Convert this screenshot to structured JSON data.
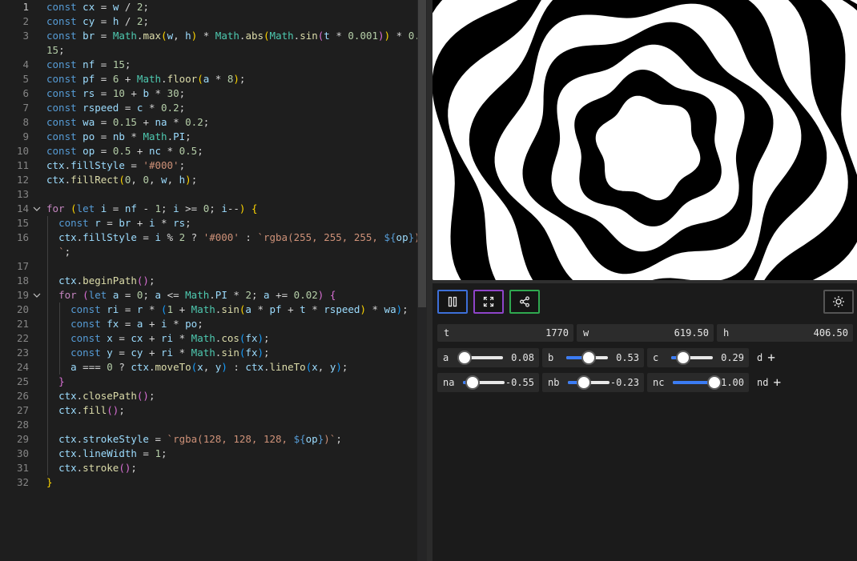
{
  "editor": {
    "lines": [
      {
        "num": "1",
        "html": "<span class=\"k\">const</span> <span class=\"v\">cx</span> = <span class=\"v\">w</span> / <span class=\"n\">2</span>;"
      },
      {
        "num": "2",
        "html": "<span class=\"k\">const</span> <span class=\"v\">cy</span> = <span class=\"v\">h</span> / <span class=\"n\">2</span>;"
      },
      {
        "num": "3",
        "html": "<span class=\"k\">const</span> <span class=\"v\">br</span> = <span class=\"t\">Math</span>.<span class=\"f\">max</span><span class=\"b1\">(</span><span class=\"v\">w</span>, <span class=\"v\">h</span><span class=\"b1\">)</span> * <span class=\"t\">Math</span>.<span class=\"f\">abs</span><span class=\"b1\">(</span><span class=\"t\">Math</span>.<span class=\"f\">sin</span><span class=\"b2\">(</span><span class=\"v\">t</span> * <span class=\"n\">0.001</span><span class=\"b2\">)</span><span class=\"b1\">)</span> * <span class=\"n\">0.</span>"
      },
      {
        "num": "",
        "html": "<span class=\"n\">15</span>;"
      },
      {
        "num": "4",
        "html": "<span class=\"k\">const</span> <span class=\"v\">nf</span> = <span class=\"n\">15</span>;"
      },
      {
        "num": "5",
        "html": "<span class=\"k\">const</span> <span class=\"v\">pf</span> = <span class=\"n\">6</span> + <span class=\"t\">Math</span>.<span class=\"f\">floor</span><span class=\"b1\">(</span><span class=\"v\">a</span> * <span class=\"n\">8</span><span class=\"b1\">)</span>;"
      },
      {
        "num": "6",
        "html": "<span class=\"k\">const</span> <span class=\"v\">rs</span> = <span class=\"n\">10</span> + <span class=\"v\">b</span> * <span class=\"n\">30</span>;"
      },
      {
        "num": "7",
        "html": "<span class=\"k\">const</span> <span class=\"v\">rspeed</span> = <span class=\"v\">c</span> * <span class=\"n\">0.2</span>;"
      },
      {
        "num": "8",
        "html": "<span class=\"k\">const</span> <span class=\"v\">wa</span> = <span class=\"n\">0.15</span> + <span class=\"v\">na</span> * <span class=\"n\">0.2</span>;"
      },
      {
        "num": "9",
        "html": "<span class=\"k\">const</span> <span class=\"v\">po</span> = <span class=\"v\">nb</span> * <span class=\"t\">Math</span>.<span class=\"v\">PI</span>;"
      },
      {
        "num": "10",
        "html": "<span class=\"k\">const</span> <span class=\"v\">op</span> = <span class=\"n\">0.5</span> + <span class=\"v\">nc</span> * <span class=\"n\">0.5</span>;"
      },
      {
        "num": "11",
        "html": "<span class=\"v\">ctx</span>.<span class=\"v\">fillStyle</span> = <span class=\"s\">'#000'</span>;"
      },
      {
        "num": "12",
        "html": "<span class=\"v\">ctx</span>.<span class=\"f\">fillRect</span><span class=\"b1\">(</span><span class=\"n\">0</span>, <span class=\"n\">0</span>, <span class=\"v\">w</span>, <span class=\"v\">h</span><span class=\"b1\">)</span>;"
      },
      {
        "num": "13",
        "html": ""
      },
      {
        "num": "14",
        "html": "<span class=\"c\">for</span> <span class=\"b1\">(</span><span class=\"k\">let</span> <span class=\"v\">i</span> = <span class=\"v\">nf</span> - <span class=\"n\">1</span>; <span class=\"v\">i</span> &gt;= <span class=\"n\">0</span>; <span class=\"v\">i</span>--<span class=\"b1\">)</span> <span class=\"b1\">{</span>"
      },
      {
        "num": "15",
        "html": "  <span class=\"k\">const</span> <span class=\"v\">r</span> = <span class=\"v\">br</span> + <span class=\"v\">i</span> * <span class=\"v\">rs</span>;"
      },
      {
        "num": "16",
        "html": "  <span class=\"v\">ctx</span>.<span class=\"v\">fillStyle</span> = <span class=\"v\">i</span> % <span class=\"n\">2</span> ? <span class=\"s\">'#000'</span> : <span class=\"s\">`rgba(255, 255, 255, </span><span class=\"k\">${</span><span class=\"v\">op</span><span class=\"k\">}</span><span class=\"s\">)</span>"
      },
      {
        "num": "",
        "html": "  <span class=\"s\">`</span>;"
      },
      {
        "num": "17",
        "html": ""
      },
      {
        "num": "18",
        "html": "  <span class=\"v\">ctx</span>.<span class=\"f\">beginPath</span><span class=\"b2\">()</span>;"
      },
      {
        "num": "19",
        "html": "  <span class=\"c\">for</span> <span class=\"b2\">(</span><span class=\"k\">let</span> <span class=\"v\">a</span> = <span class=\"n\">0</span>; <span class=\"v\">a</span> &lt;= <span class=\"t\">Math</span>.<span class=\"v\">PI</span> * <span class=\"n\">2</span>; <span class=\"v\">a</span> += <span class=\"n\">0.02</span><span class=\"b2\">)</span> <span class=\"b2\">{</span>"
      },
      {
        "num": "20",
        "html": "    <span class=\"k\">const</span> <span class=\"v\">ri</span> = <span class=\"v\">r</span> * <span class=\"b3\">(</span><span class=\"n\">1</span> + <span class=\"t\">Math</span>.<span class=\"f\">sin</span><span class=\"b1\">(</span><span class=\"v\">a</span> * <span class=\"v\">pf</span> + <span class=\"v\">t</span> * <span class=\"v\">rspeed</span><span class=\"b1\">)</span> * <span class=\"v\">wa</span><span class=\"b3\">)</span>;"
      },
      {
        "num": "21",
        "html": "    <span class=\"k\">const</span> <span class=\"v\">fx</span> = <span class=\"v\">a</span> + <span class=\"v\">i</span> * <span class=\"v\">po</span>;"
      },
      {
        "num": "22",
        "html": "    <span class=\"k\">const</span> <span class=\"v\">x</span> = <span class=\"v\">cx</span> + <span class=\"v\">ri</span> * <span class=\"t\">Math</span>.<span class=\"f\">cos</span><span class=\"b3\">(</span><span class=\"v\">fx</span><span class=\"b3\">)</span>;"
      },
      {
        "num": "23",
        "html": "    <span class=\"k\">const</span> <span class=\"v\">y</span> = <span class=\"v\">cy</span> + <span class=\"v\">ri</span> * <span class=\"t\">Math</span>.<span class=\"f\">sin</span><span class=\"b3\">(</span><span class=\"v\">fx</span><span class=\"b3\">)</span>;"
      },
      {
        "num": "24",
        "html": "    <span class=\"v\">a</span> === <span class=\"n\">0</span> ? <span class=\"v\">ctx</span>.<span class=\"f\">moveTo</span><span class=\"b3\">(</span><span class=\"v\">x</span>, <span class=\"v\">y</span><span class=\"b3\">)</span> : <span class=\"v\">ctx</span>.<span class=\"f\">lineTo</span><span class=\"b3\">(</span><span class=\"v\">x</span>, <span class=\"v\">y</span><span class=\"b3\">)</span>;"
      },
      {
        "num": "25",
        "html": "  <span class=\"b2\">}</span>"
      },
      {
        "num": "26",
        "html": "  <span class=\"v\">ctx</span>.<span class=\"f\">closePath</span><span class=\"b2\">()</span>;"
      },
      {
        "num": "27",
        "html": "  <span class=\"v\">ctx</span>.<span class=\"f\">fill</span><span class=\"b2\">()</span>;"
      },
      {
        "num": "28",
        "html": ""
      },
      {
        "num": "29",
        "html": "  <span class=\"v\">ctx</span>.<span class=\"v\">strokeStyle</span> = <span class=\"s\">`rgba(128, 128, 128, </span><span class=\"k\">${</span><span class=\"v\">op</span><span class=\"k\">}</span><span class=\"s\">)`</span>;"
      },
      {
        "num": "30",
        "html": "  <span class=\"v\">ctx</span>.<span class=\"v\">lineWidth</span> = <span class=\"n\">1</span>;"
      },
      {
        "num": "31",
        "html": "  <span class=\"v\">ctx</span>.<span class=\"f\">stroke</span><span class=\"b2\">()</span>;"
      },
      {
        "num": "32",
        "html": "<span class=\"b1\">}</span>"
      }
    ],
    "text": [
      "const cx = w / 2;",
      "const cy = h / 2;",
      "const br = Math.max(w, h) * Math.abs(Math.sin(t * 0.001)) * 0.",
      "15;",
      "const nf = 15;",
      "const pf = 6 + Math.floor(a * 8);",
      "const rs = 10 + b * 30;",
      "const rspeed = c * 0.2;",
      "const wa = 0.15 + na * 0.2;",
      "const po = nb * Math.PI;",
      "const op = 0.5 + nc * 0.5;",
      "ctx.fillStyle = '#000';",
      "ctx.fillRect(0, 0, w, h);",
      "",
      "for (let i = nf - 1; i >= 0; i--) {",
      "  const r = br + i * rs;",
      "  ctx.fillStyle = i % 2 ? '#000' : `rgba(255, 255, 255, ${op})",
      "  `;",
      "",
      "  ctx.beginPath();",
      "  for (let a = 0; a <= Math.PI * 2; a += 0.02) {",
      "    const ri = r * (1 + Math.sin(a * pf + t * rspeed) * wa);",
      "    const fx = a + i * po;",
      "    const x = cx + ri * Math.cos(fx);",
      "    const y = cy + ri * Math.sin(fx);",
      "    a === 0 ? ctx.moveTo(x, y) : ctx.lineTo(x, y);",
      "  }",
      "  ctx.closePath();",
      "  ctx.fill();",
      "",
      "  ctx.strokeStyle = `rgba(128, 128, 128, ${op})`;",
      "  ctx.lineWidth = 1;",
      "  ctx.stroke();",
      "}"
    ],
    "active_line": "1",
    "fold_lines": [
      "14",
      "19"
    ]
  },
  "toolbar": {
    "pause_icon": "pause-icon",
    "fullscreen_icon": "fullscreen-icon",
    "share_icon": "share-icon",
    "theme_icon": "sun-icon",
    "colors": {
      "pause": "#3d6fd8",
      "fullscreen": "#8e44c9",
      "share": "#2fa84f",
      "theme": "#555555"
    }
  },
  "readouts": [
    {
      "label": "t",
      "value": "1770"
    },
    {
      "label": "w",
      "value": "619.50"
    },
    {
      "label": "h",
      "value": "406.50"
    }
  ],
  "sliders_row1": [
    {
      "label": "a",
      "value": "0.08",
      "fraction": 0.08
    },
    {
      "label": "b",
      "value": "0.53",
      "fraction": 0.53
    },
    {
      "label": "c",
      "value": "0.29",
      "fraction": 0.29
    }
  ],
  "sliders_row2": [
    {
      "label": "na",
      "value": "-0.55",
      "fraction": 0.225
    },
    {
      "label": "nb",
      "value": "-0.23",
      "fraction": 0.385
    },
    {
      "label": "nc",
      "value": "1.00",
      "fraction": 1.0
    }
  ],
  "add_row1": {
    "label": "d",
    "icon": "plus-icon"
  },
  "add_row2": {
    "label": "nd",
    "icon": "plus-icon"
  },
  "accent": "#3b7cf4"
}
